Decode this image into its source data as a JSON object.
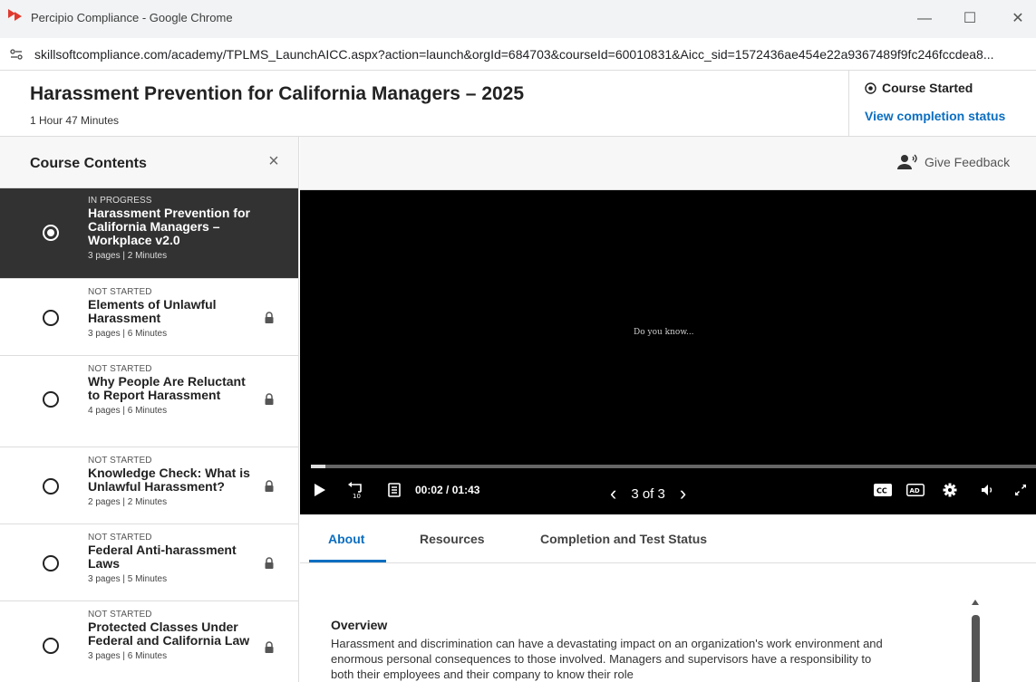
{
  "window": {
    "title": "Percipio Compliance - Google Chrome",
    "url": "skillsoftcompliance.com/academy/TPLMS_LaunchAICC.aspx?action=launch&orgId=684703&courseId=60010831&Aicc_sid=1572436ae454e22a9367489f9fc246fccdea8...",
    "minimize": "—",
    "maximize": "☐",
    "close": "✕"
  },
  "course": {
    "title": "Harassment Prevention for California Managers – 2025",
    "duration": "1 Hour 47 Minutes",
    "status": "Course Started",
    "view_status": "View completion status"
  },
  "sidebar": {
    "heading": "Course Contents",
    "close": "×",
    "items": [
      {
        "status": "IN PROGRESS",
        "name": "Harassment Prevention for California Managers – Workplace v2.0",
        "meta": "3 pages | 2 Minutes",
        "active": true,
        "locked": false
      },
      {
        "status": "NOT STARTED",
        "name": "Elements of Unlawful Harassment",
        "meta": "3 pages | 6 Minutes",
        "active": false,
        "locked": true
      },
      {
        "status": "NOT STARTED",
        "name": "Why People Are Reluctant to Report Harassment",
        "meta": "4 pages | 6 Minutes",
        "active": false,
        "locked": true
      },
      {
        "status": "NOT STARTED",
        "name": "Knowledge Check: What is Unlawful Harassment?",
        "meta": "2 pages | 2 Minutes",
        "active": false,
        "locked": true
      },
      {
        "status": "NOT STARTED",
        "name": "Federal Anti-harassment Laws",
        "meta": "3 pages | 5 Minutes",
        "active": false,
        "locked": true
      },
      {
        "status": "NOT STARTED",
        "name": "Protected Classes Under Federal and California Law",
        "meta": "3 pages | 6 Minutes",
        "active": false,
        "locked": true
      }
    ]
  },
  "feedback": {
    "label": "Give Feedback"
  },
  "player": {
    "caption": "Do you know...",
    "progress": 0.02,
    "current_time": "00:02",
    "separator": "/",
    "total_time": "01:43",
    "page": "3 of 3",
    "prev": "‹",
    "next": "›",
    "cc": "CC",
    "ad": "AD"
  },
  "tabs": [
    {
      "label": "About",
      "active": true
    },
    {
      "label": "Resources",
      "active": false
    },
    {
      "label": "Completion and Test Status",
      "active": false
    }
  ],
  "overview": {
    "heading": "Overview",
    "body": "Harassment and discrimination can have a devastating impact on an organization's work environment and enormous personal consequences to those involved. Managers and supervisors have a responsibility to both their employees and their company to know their role"
  }
}
